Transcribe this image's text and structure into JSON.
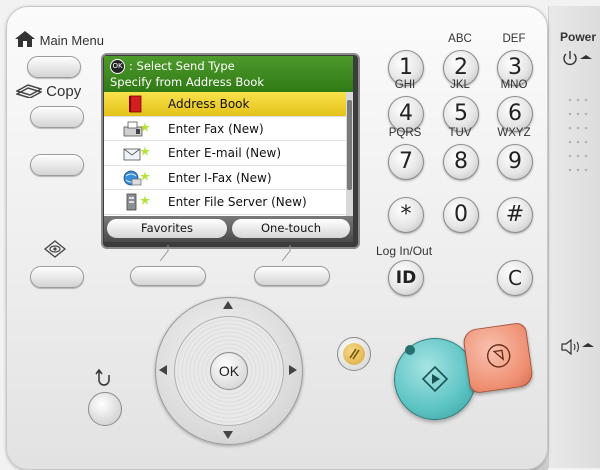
{
  "left_panel": {
    "main_menu_label": "Main Menu",
    "copy_label": "Copy"
  },
  "screen": {
    "header_ok": "OK",
    "header_line1": ": Select Send Type",
    "header_line2": "Specify from Address Book",
    "items": [
      {
        "label": "Address Book",
        "icon": "address-book-icon",
        "selected": true
      },
      {
        "label": "Enter Fax (New)",
        "icon": "fax-icon",
        "selected": false
      },
      {
        "label": "Enter E-mail (New)",
        "icon": "email-icon",
        "selected": false
      },
      {
        "label": "Enter I-Fax (New)",
        "icon": "ifax-icon",
        "selected": false
      },
      {
        "label": "Enter File Server (New)",
        "icon": "file-server-icon",
        "selected": false
      }
    ],
    "footer": {
      "left": "Favorites",
      "right": "One-touch"
    }
  },
  "keypad": {
    "keys": [
      {
        "digit": "1",
        "letters": ""
      },
      {
        "digit": "2",
        "letters": "ABC"
      },
      {
        "digit": "3",
        "letters": "DEF"
      },
      {
        "digit": "4",
        "letters": "GHI"
      },
      {
        "digit": "5",
        "letters": "JKL"
      },
      {
        "digit": "6",
        "letters": "MNO"
      },
      {
        "digit": "7",
        "letters": "PQRS"
      },
      {
        "digit": "8",
        "letters": "TUV"
      },
      {
        "digit": "9",
        "letters": "WXYZ"
      },
      {
        "digit": "*",
        "letters": ""
      },
      {
        "digit": "0",
        "letters": ""
      },
      {
        "digit": "#",
        "letters": ""
      }
    ],
    "login_label": "Log In/Out",
    "id_label": "ID",
    "clear_label": "C"
  },
  "dpad": {
    "ok_label": "OK"
  },
  "power": {
    "label": "Power"
  },
  "colors": {
    "screen_header": "#3f8a20",
    "selection": "#f2d43a",
    "start_button": "#5cc3c3",
    "stop_button": "#f08f72",
    "pause_button": "#e3b951",
    "led": "#b8ff2a"
  }
}
